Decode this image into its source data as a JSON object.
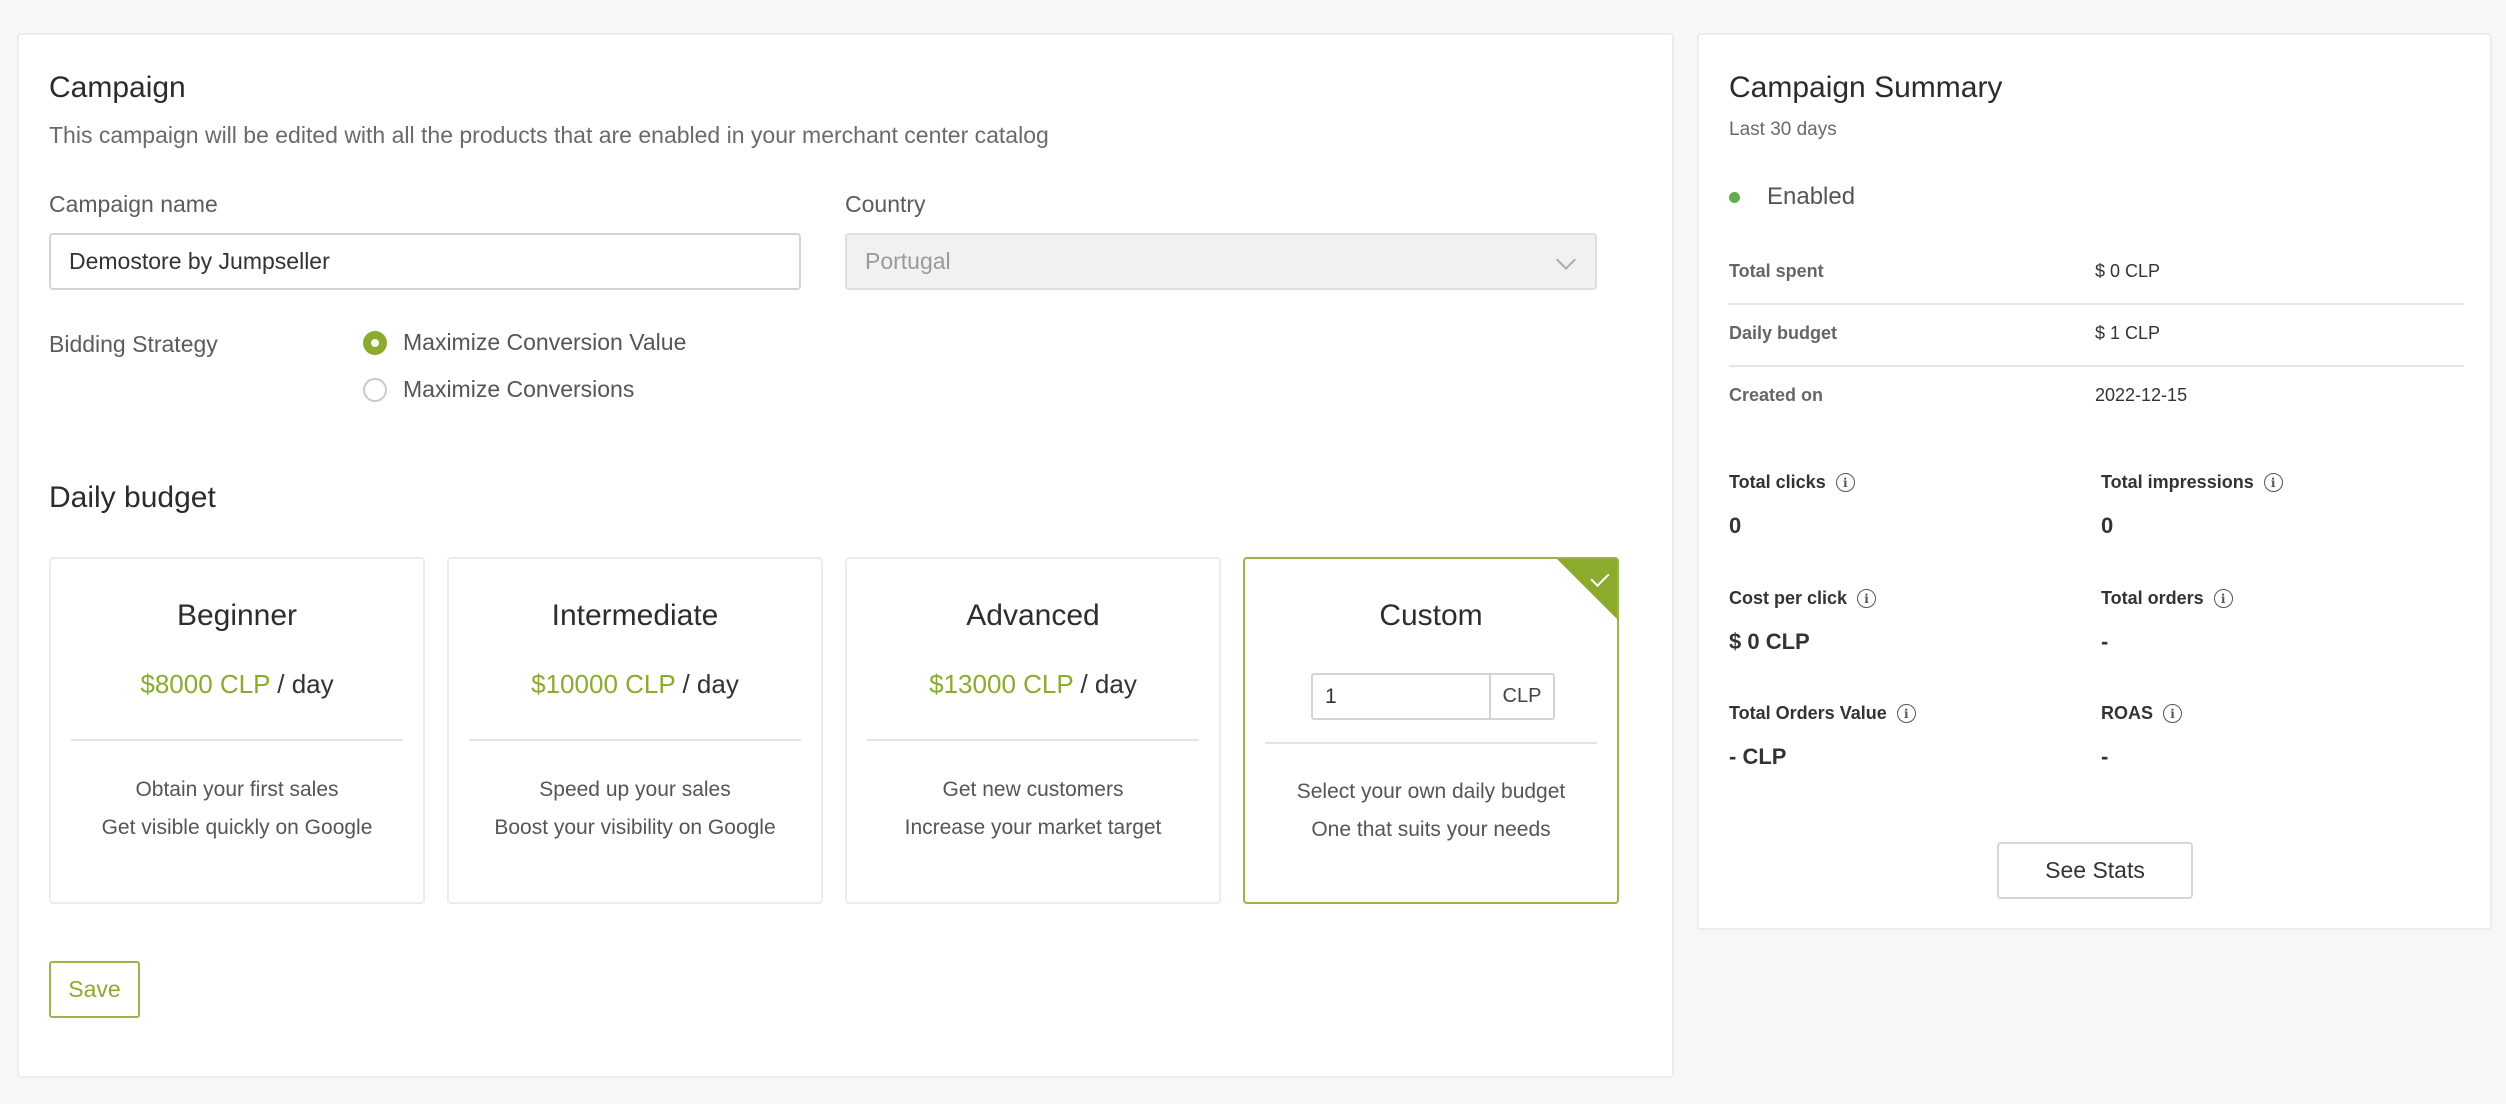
{
  "campaign": {
    "title": "Campaign",
    "description": "This campaign will be edited with all the products that are enabled in your merchant center catalog",
    "name_label": "Campaign name",
    "name_value": "Demostore by Jumpseller",
    "country_label": "Country",
    "country_value": "Portugal",
    "bidding_label": "Bidding Strategy",
    "bidding_options": [
      {
        "label": "Maximize Conversion Value",
        "selected": true
      },
      {
        "label": "Maximize Conversions",
        "selected": false
      }
    ]
  },
  "budget": {
    "title": "Daily budget",
    "per_day": "/ day",
    "cards": [
      {
        "title": "Beginner",
        "amount": "$8000 CLP",
        "line1": "Obtain your first sales",
        "line2": "Get visible quickly on Google"
      },
      {
        "title": "Intermediate",
        "amount": "$10000 CLP",
        "line1": "Speed up your sales",
        "line2": "Boost your visibility on Google"
      },
      {
        "title": "Advanced",
        "amount": "$13000 CLP",
        "line1": "Get new customers",
        "line2": "Increase your market target"
      }
    ],
    "custom": {
      "title": "Custom",
      "value": "1",
      "unit": "CLP",
      "line1": "Select your own daily budget",
      "line2": "One that suits your needs",
      "selected": true
    },
    "save_label": "Save"
  },
  "summary": {
    "title": "Campaign Summary",
    "period": "Last 30 days",
    "status": "Enabled",
    "rows": [
      {
        "label": "Total spent",
        "value": "$ 0 CLP"
      },
      {
        "label": "Daily budget",
        "value": "$ 1 CLP"
      },
      {
        "label": "Created on",
        "value": "2022-12-15"
      }
    ],
    "stats": [
      {
        "label": "Total clicks",
        "value": "0"
      },
      {
        "label": "Total impressions",
        "value": "0"
      },
      {
        "label": "Cost per click",
        "value": "$ 0 CLP"
      },
      {
        "label": "Total orders",
        "value": "-"
      },
      {
        "label": "Total Orders Value",
        "value": "- CLP"
      },
      {
        "label": "ROAS",
        "value": "-"
      }
    ],
    "see_stats_label": "See Stats"
  },
  "colors": {
    "accent": "#8bab2e",
    "status": "#5fae4d"
  },
  "icons": {
    "info": "info-icon",
    "check": "check-icon",
    "chevron": "chevron-down-icon"
  }
}
